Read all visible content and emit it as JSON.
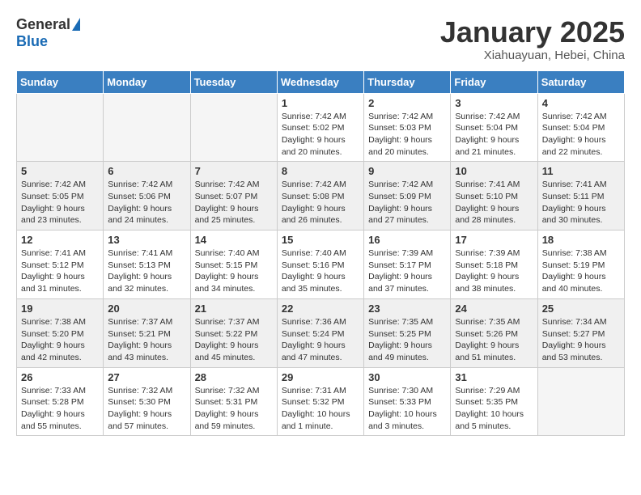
{
  "logo": {
    "general": "General",
    "blue": "Blue"
  },
  "title": "January 2025",
  "subtitle": "Xiahuayuan, Hebei, China",
  "headers": [
    "Sunday",
    "Monday",
    "Tuesday",
    "Wednesday",
    "Thursday",
    "Friday",
    "Saturday"
  ],
  "weeks": [
    [
      {
        "day": "",
        "info": ""
      },
      {
        "day": "",
        "info": ""
      },
      {
        "day": "",
        "info": ""
      },
      {
        "day": "1",
        "info": "Sunrise: 7:42 AM\nSunset: 5:02 PM\nDaylight: 9 hours\nand 20 minutes."
      },
      {
        "day": "2",
        "info": "Sunrise: 7:42 AM\nSunset: 5:03 PM\nDaylight: 9 hours\nand 20 minutes."
      },
      {
        "day": "3",
        "info": "Sunrise: 7:42 AM\nSunset: 5:04 PM\nDaylight: 9 hours\nand 21 minutes."
      },
      {
        "day": "4",
        "info": "Sunrise: 7:42 AM\nSunset: 5:04 PM\nDaylight: 9 hours\nand 22 minutes."
      }
    ],
    [
      {
        "day": "5",
        "info": "Sunrise: 7:42 AM\nSunset: 5:05 PM\nDaylight: 9 hours\nand 23 minutes."
      },
      {
        "day": "6",
        "info": "Sunrise: 7:42 AM\nSunset: 5:06 PM\nDaylight: 9 hours\nand 24 minutes."
      },
      {
        "day": "7",
        "info": "Sunrise: 7:42 AM\nSunset: 5:07 PM\nDaylight: 9 hours\nand 25 minutes."
      },
      {
        "day": "8",
        "info": "Sunrise: 7:42 AM\nSunset: 5:08 PM\nDaylight: 9 hours\nand 26 minutes."
      },
      {
        "day": "9",
        "info": "Sunrise: 7:42 AM\nSunset: 5:09 PM\nDaylight: 9 hours\nand 27 minutes."
      },
      {
        "day": "10",
        "info": "Sunrise: 7:41 AM\nSunset: 5:10 PM\nDaylight: 9 hours\nand 28 minutes."
      },
      {
        "day": "11",
        "info": "Sunrise: 7:41 AM\nSunset: 5:11 PM\nDaylight: 9 hours\nand 30 minutes."
      }
    ],
    [
      {
        "day": "12",
        "info": "Sunrise: 7:41 AM\nSunset: 5:12 PM\nDaylight: 9 hours\nand 31 minutes."
      },
      {
        "day": "13",
        "info": "Sunrise: 7:41 AM\nSunset: 5:13 PM\nDaylight: 9 hours\nand 32 minutes."
      },
      {
        "day": "14",
        "info": "Sunrise: 7:40 AM\nSunset: 5:15 PM\nDaylight: 9 hours\nand 34 minutes."
      },
      {
        "day": "15",
        "info": "Sunrise: 7:40 AM\nSunset: 5:16 PM\nDaylight: 9 hours\nand 35 minutes."
      },
      {
        "day": "16",
        "info": "Sunrise: 7:39 AM\nSunset: 5:17 PM\nDaylight: 9 hours\nand 37 minutes."
      },
      {
        "day": "17",
        "info": "Sunrise: 7:39 AM\nSunset: 5:18 PM\nDaylight: 9 hours\nand 38 minutes."
      },
      {
        "day": "18",
        "info": "Sunrise: 7:38 AM\nSunset: 5:19 PM\nDaylight: 9 hours\nand 40 minutes."
      }
    ],
    [
      {
        "day": "19",
        "info": "Sunrise: 7:38 AM\nSunset: 5:20 PM\nDaylight: 9 hours\nand 42 minutes."
      },
      {
        "day": "20",
        "info": "Sunrise: 7:37 AM\nSunset: 5:21 PM\nDaylight: 9 hours\nand 43 minutes."
      },
      {
        "day": "21",
        "info": "Sunrise: 7:37 AM\nSunset: 5:22 PM\nDaylight: 9 hours\nand 45 minutes."
      },
      {
        "day": "22",
        "info": "Sunrise: 7:36 AM\nSunset: 5:24 PM\nDaylight: 9 hours\nand 47 minutes."
      },
      {
        "day": "23",
        "info": "Sunrise: 7:35 AM\nSunset: 5:25 PM\nDaylight: 9 hours\nand 49 minutes."
      },
      {
        "day": "24",
        "info": "Sunrise: 7:35 AM\nSunset: 5:26 PM\nDaylight: 9 hours\nand 51 minutes."
      },
      {
        "day": "25",
        "info": "Sunrise: 7:34 AM\nSunset: 5:27 PM\nDaylight: 9 hours\nand 53 minutes."
      }
    ],
    [
      {
        "day": "26",
        "info": "Sunrise: 7:33 AM\nSunset: 5:28 PM\nDaylight: 9 hours\nand 55 minutes."
      },
      {
        "day": "27",
        "info": "Sunrise: 7:32 AM\nSunset: 5:30 PM\nDaylight: 9 hours\nand 57 minutes."
      },
      {
        "day": "28",
        "info": "Sunrise: 7:32 AM\nSunset: 5:31 PM\nDaylight: 9 hours\nand 59 minutes."
      },
      {
        "day": "29",
        "info": "Sunrise: 7:31 AM\nSunset: 5:32 PM\nDaylight: 10 hours\nand 1 minute."
      },
      {
        "day": "30",
        "info": "Sunrise: 7:30 AM\nSunset: 5:33 PM\nDaylight: 10 hours\nand 3 minutes."
      },
      {
        "day": "31",
        "info": "Sunrise: 7:29 AM\nSunset: 5:35 PM\nDaylight: 10 hours\nand 5 minutes."
      },
      {
        "day": "",
        "info": ""
      }
    ]
  ]
}
